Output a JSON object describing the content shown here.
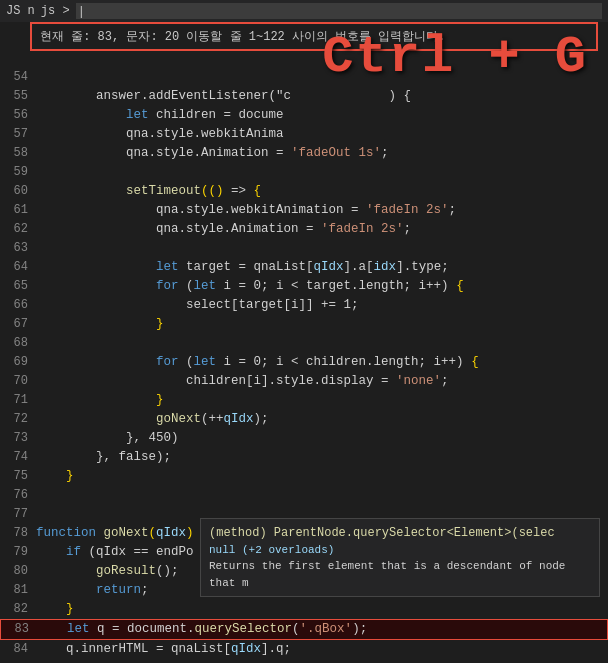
{
  "editor": {
    "title": "JS n",
    "breadcrumb": "js >",
    "goto_bar_text": "현재 줄: 83, 문자: 20 이동할 줄 1~122 사이의 번호를 입력합니다.",
    "ctrl_g_label": "Ctrl + G",
    "lines": [
      {
        "num": "54",
        "tokens": []
      },
      {
        "num": "55",
        "tokens": [
          {
            "t": "plain",
            "v": "        answer.addEventListener(\"c"
          },
          {
            "t": "plain",
            "v": "             ) {"
          }
        ]
      },
      {
        "num": "56",
        "tokens": [
          {
            "t": "plain",
            "v": "            "
          },
          {
            "t": "kw",
            "v": "let"
          },
          {
            "t": "plain",
            "v": " children = docume"
          }
        ]
      },
      {
        "num": "57",
        "tokens": [
          {
            "t": "plain",
            "v": "            qna.style.webkitAnima"
          }
        ]
      },
      {
        "num": "58",
        "tokens": [
          {
            "t": "plain",
            "v": "            qna.style.Animation = "
          },
          {
            "t": "str",
            "v": "'fadeOut 1s'"
          },
          {
            "t": "plain",
            "v": ";"
          }
        ]
      },
      {
        "num": "59",
        "tokens": []
      },
      {
        "num": "60",
        "tokens": [
          {
            "t": "plain",
            "v": "            "
          },
          {
            "t": "fn",
            "v": "setTimeout"
          },
          {
            "t": "paren",
            "v": "("
          },
          {
            "t": "paren",
            "v": "("
          },
          {
            "t": "paren",
            "v": ")"
          },
          {
            "t": "plain",
            "v": " => "
          },
          {
            "t": "paren",
            "v": "{"
          }
        ]
      },
      {
        "num": "61",
        "tokens": [
          {
            "t": "plain",
            "v": "                qna.style.webkitAnimation = "
          },
          {
            "t": "str",
            "v": "'fadeIn 2s'"
          },
          {
            "t": "plain",
            "v": ";"
          }
        ]
      },
      {
        "num": "62",
        "tokens": [
          {
            "t": "plain",
            "v": "                qna.style.Animation = "
          },
          {
            "t": "str",
            "v": "'fadeIn 2s'"
          },
          {
            "t": "plain",
            "v": ";"
          }
        ]
      },
      {
        "num": "63",
        "tokens": []
      },
      {
        "num": "64",
        "tokens": [
          {
            "t": "plain",
            "v": "                "
          },
          {
            "t": "kw",
            "v": "let"
          },
          {
            "t": "plain",
            "v": " target = qnaList["
          },
          {
            "t": "var",
            "v": "qIdx"
          },
          {
            "t": "plain",
            "v": "].a["
          },
          {
            "t": "var",
            "v": "idx"
          },
          {
            "t": "plain",
            "v": "].type;"
          }
        ]
      },
      {
        "num": "65",
        "tokens": [
          {
            "t": "plain",
            "v": "                "
          },
          {
            "t": "kw",
            "v": "for"
          },
          {
            "t": "plain",
            "v": " ("
          },
          {
            "t": "kw",
            "v": "let"
          },
          {
            "t": "plain",
            "v": " i = 0; i < target.length; i++) "
          },
          {
            "t": "paren",
            "v": "{"
          }
        ]
      },
      {
        "num": "66",
        "tokens": [
          {
            "t": "plain",
            "v": "                    select[target[i]] += 1;"
          }
        ]
      },
      {
        "num": "67",
        "tokens": [
          {
            "t": "paren",
            "v": "                }"
          }
        ]
      },
      {
        "num": "68",
        "tokens": []
      },
      {
        "num": "69",
        "tokens": [
          {
            "t": "plain",
            "v": "                "
          },
          {
            "t": "kw",
            "v": "for"
          },
          {
            "t": "plain",
            "v": " ("
          },
          {
            "t": "kw",
            "v": "let"
          },
          {
            "t": "plain",
            "v": " i = 0; i < children.length; i++) "
          },
          {
            "t": "paren",
            "v": "{"
          }
        ]
      },
      {
        "num": "70",
        "tokens": [
          {
            "t": "plain",
            "v": "                    children[i].style.display = "
          },
          {
            "t": "str",
            "v": "'none'"
          },
          {
            "t": "plain",
            "v": ";"
          }
        ]
      },
      {
        "num": "71",
        "tokens": [
          {
            "t": "paren",
            "v": "                }"
          }
        ]
      },
      {
        "num": "72",
        "tokens": [
          {
            "t": "plain",
            "v": "                "
          },
          {
            "t": "fn",
            "v": "goNext"
          },
          {
            "t": "plain",
            "v": "(++"
          },
          {
            "t": "var",
            "v": "qIdx"
          },
          {
            "t": "plain",
            "v": ");"
          }
        ]
      },
      {
        "num": "73",
        "tokens": [
          {
            "t": "plain",
            "v": "            }, 450)"
          }
        ]
      },
      {
        "num": "74",
        "tokens": [
          {
            "t": "plain",
            "v": "        }, false);"
          }
        ]
      },
      {
        "num": "75",
        "tokens": [
          {
            "t": "paren",
            "v": "    }"
          }
        ]
      },
      {
        "num": "76",
        "tokens": []
      },
      {
        "num": "77",
        "tokens": []
      },
      {
        "num": "78",
        "tokens": [
          {
            "t": "kw",
            "v": "function"
          },
          {
            "t": "plain",
            "v": " "
          },
          {
            "t": "fn",
            "v": "goNext"
          },
          {
            "t": "paren",
            "v": "("
          },
          {
            "t": "var",
            "v": "qIdx"
          },
          {
            "t": "paren",
            "v": ")"
          },
          {
            "t": "plain",
            "v": " "
          },
          {
            "t": "paren",
            "v": "{"
          }
        ]
      },
      {
        "num": "79",
        "tokens": [
          {
            "t": "plain",
            "v": "    "
          },
          {
            "t": "kw",
            "v": "if"
          },
          {
            "t": "plain",
            "v": " (qIdx == endPo"
          }
        ]
      },
      {
        "num": "80",
        "tokens": [
          {
            "t": "plain",
            "v": "        "
          },
          {
            "t": "fn",
            "v": "goResult"
          },
          {
            "t": "plain",
            "v": "();"
          }
        ]
      },
      {
        "num": "81",
        "tokens": [
          {
            "t": "plain",
            "v": "        "
          },
          {
            "t": "kw",
            "v": "return"
          },
          {
            "t": "plain",
            "v": ";"
          }
        ]
      },
      {
        "num": "82",
        "tokens": [
          {
            "t": "paren",
            "v": "    }"
          }
        ]
      },
      {
        "num": "83",
        "tokens": [
          {
            "t": "plain",
            "v": "    "
          },
          {
            "t": "kw",
            "v": "let"
          },
          {
            "t": "plain",
            "v": " q = document."
          },
          {
            "t": "fn",
            "v": "querySelector"
          },
          {
            "t": "plain",
            "v": "("
          },
          {
            "t": "str",
            "v": "'.qBox'"
          },
          {
            "t": "plain",
            "v": ");"
          }
        ],
        "highlighted": true
      },
      {
        "num": "84",
        "tokens": [
          {
            "t": "plain",
            "v": "    q.innerHTML = qnaList["
          },
          {
            "t": "var",
            "v": "qIdx"
          },
          {
            "t": "plain",
            "v": "].q;"
          }
        ]
      }
    ],
    "tooltip": {
      "line1": "(method) ParentNode.querySelector<Element>(selec",
      "line2": "null (+2 overloads)",
      "line3": "Returns the first element that is a descendant of node that m"
    }
  }
}
